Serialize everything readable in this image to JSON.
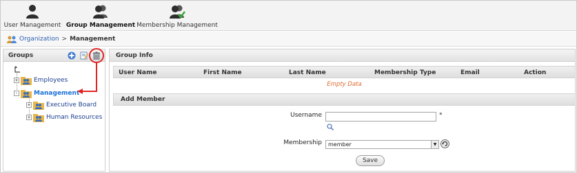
{
  "toolbar": {
    "items": [
      {
        "label": "User Management",
        "icon": "user-icon",
        "active": false
      },
      {
        "label": "Group Management",
        "icon": "group-icon",
        "active": true
      },
      {
        "label": "Membership Management",
        "icon": "membership-icon",
        "active": false
      }
    ]
  },
  "breadcrumb": {
    "icon": "organization-icon",
    "link": "Organization",
    "separator": ">",
    "current": "Management"
  },
  "groups_panel": {
    "title": "Groups",
    "actions": [
      {
        "name": "add-group-button",
        "icon": "plus-icon"
      },
      {
        "name": "edit-group-button",
        "icon": "edit-icon"
      },
      {
        "name": "delete-group-button",
        "icon": "trash-icon"
      }
    ],
    "up_icon": "level-up-icon",
    "tree": [
      {
        "label": "Employees",
        "level": 1,
        "expander": "+",
        "selected": false
      },
      {
        "label": "Management",
        "level": 1,
        "expander": "-",
        "selected": true
      },
      {
        "label": "Executive Board",
        "level": 2,
        "expander": "+",
        "selected": false
      },
      {
        "label": "Human Resources",
        "level": 2,
        "expander": "+",
        "selected": false
      }
    ]
  },
  "group_info": {
    "title": "Group Info",
    "columns": [
      "User Name",
      "First Name",
      "Last Name",
      "Membership Type",
      "Email",
      "Action"
    ],
    "empty_text": "Empty Data"
  },
  "add_member": {
    "title": "Add Member",
    "username_label": "Username",
    "username_value": "",
    "required_mark": "*",
    "membership_label": "Membership",
    "membership_value": "member",
    "save_label": "Save"
  },
  "colors": {
    "annotation": "#e02424",
    "selected_text": "#1a6fd8",
    "empty_text": "#e0692b"
  }
}
